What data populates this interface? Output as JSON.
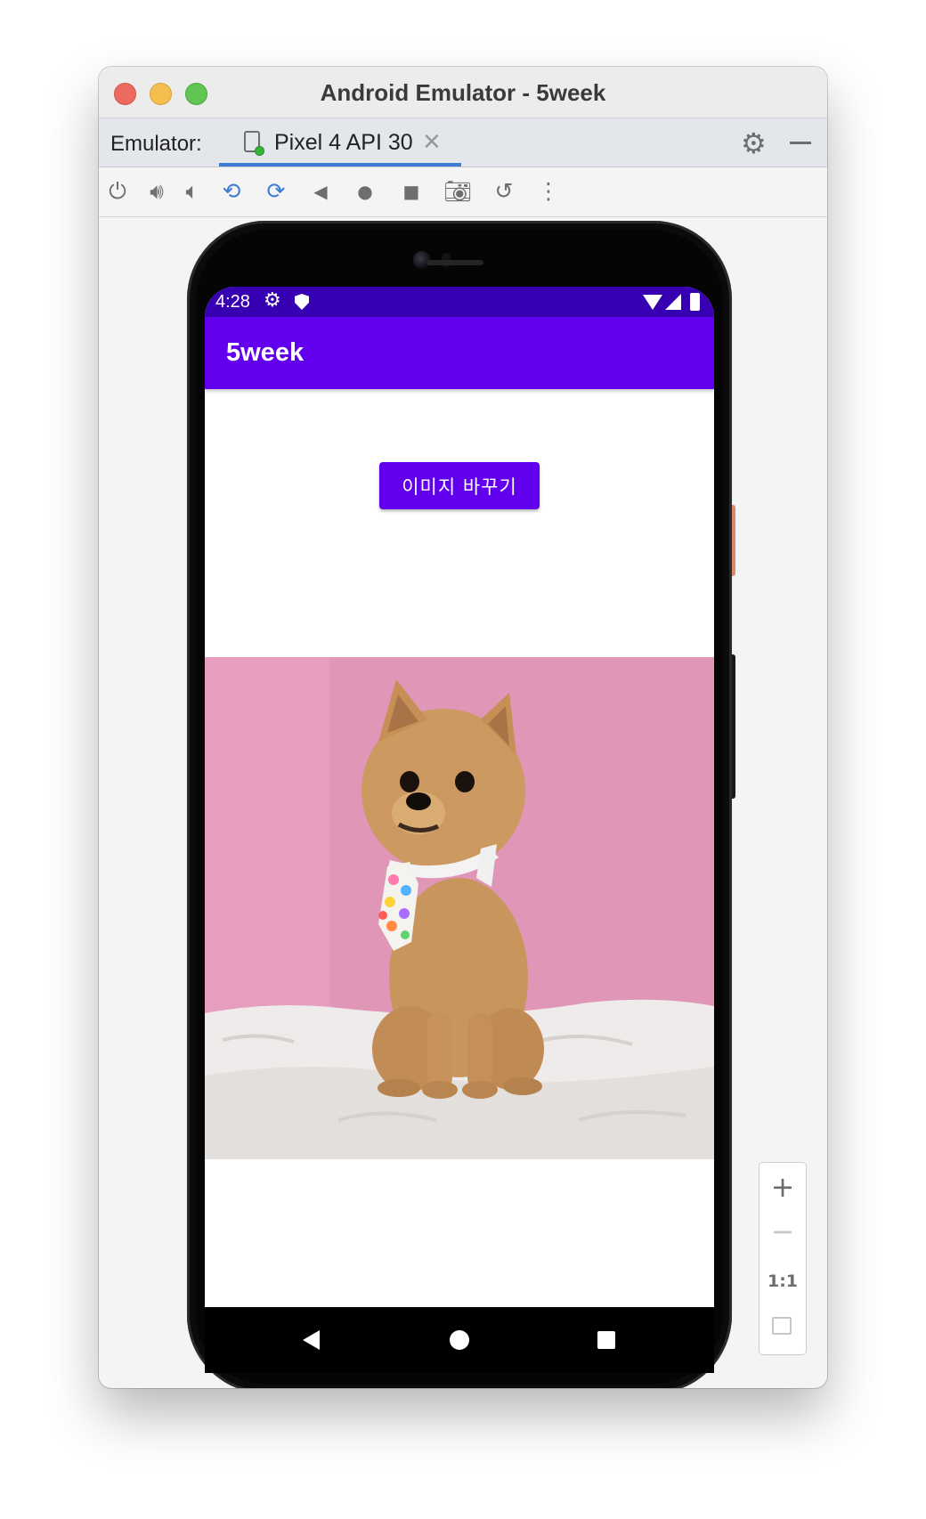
{
  "window": {
    "title": "Android Emulator - 5week"
  },
  "tabbar": {
    "emulator_label": "Emulator:",
    "tab_label": "Pixel 4 API 30",
    "close_glyph": "✕"
  },
  "toolbar": {
    "icons": [
      "power-icon",
      "volume-up-icon",
      "volume-down-icon",
      "rotate-left-icon",
      "rotate-right-icon",
      "back-icon",
      "home-icon",
      "overview-icon",
      "screenshot-icon",
      "snapshot-icon",
      "more-icon"
    ]
  },
  "device": {
    "status_time": "4:28",
    "app_title": "5week",
    "button_label": "이미지 바꾸기",
    "colors": {
      "status": "#3700b3",
      "appbar": "#6200ee",
      "button": "#6200ee"
    }
  },
  "zoom": {
    "in": "+",
    "out": "−",
    "actual": "1:1"
  }
}
